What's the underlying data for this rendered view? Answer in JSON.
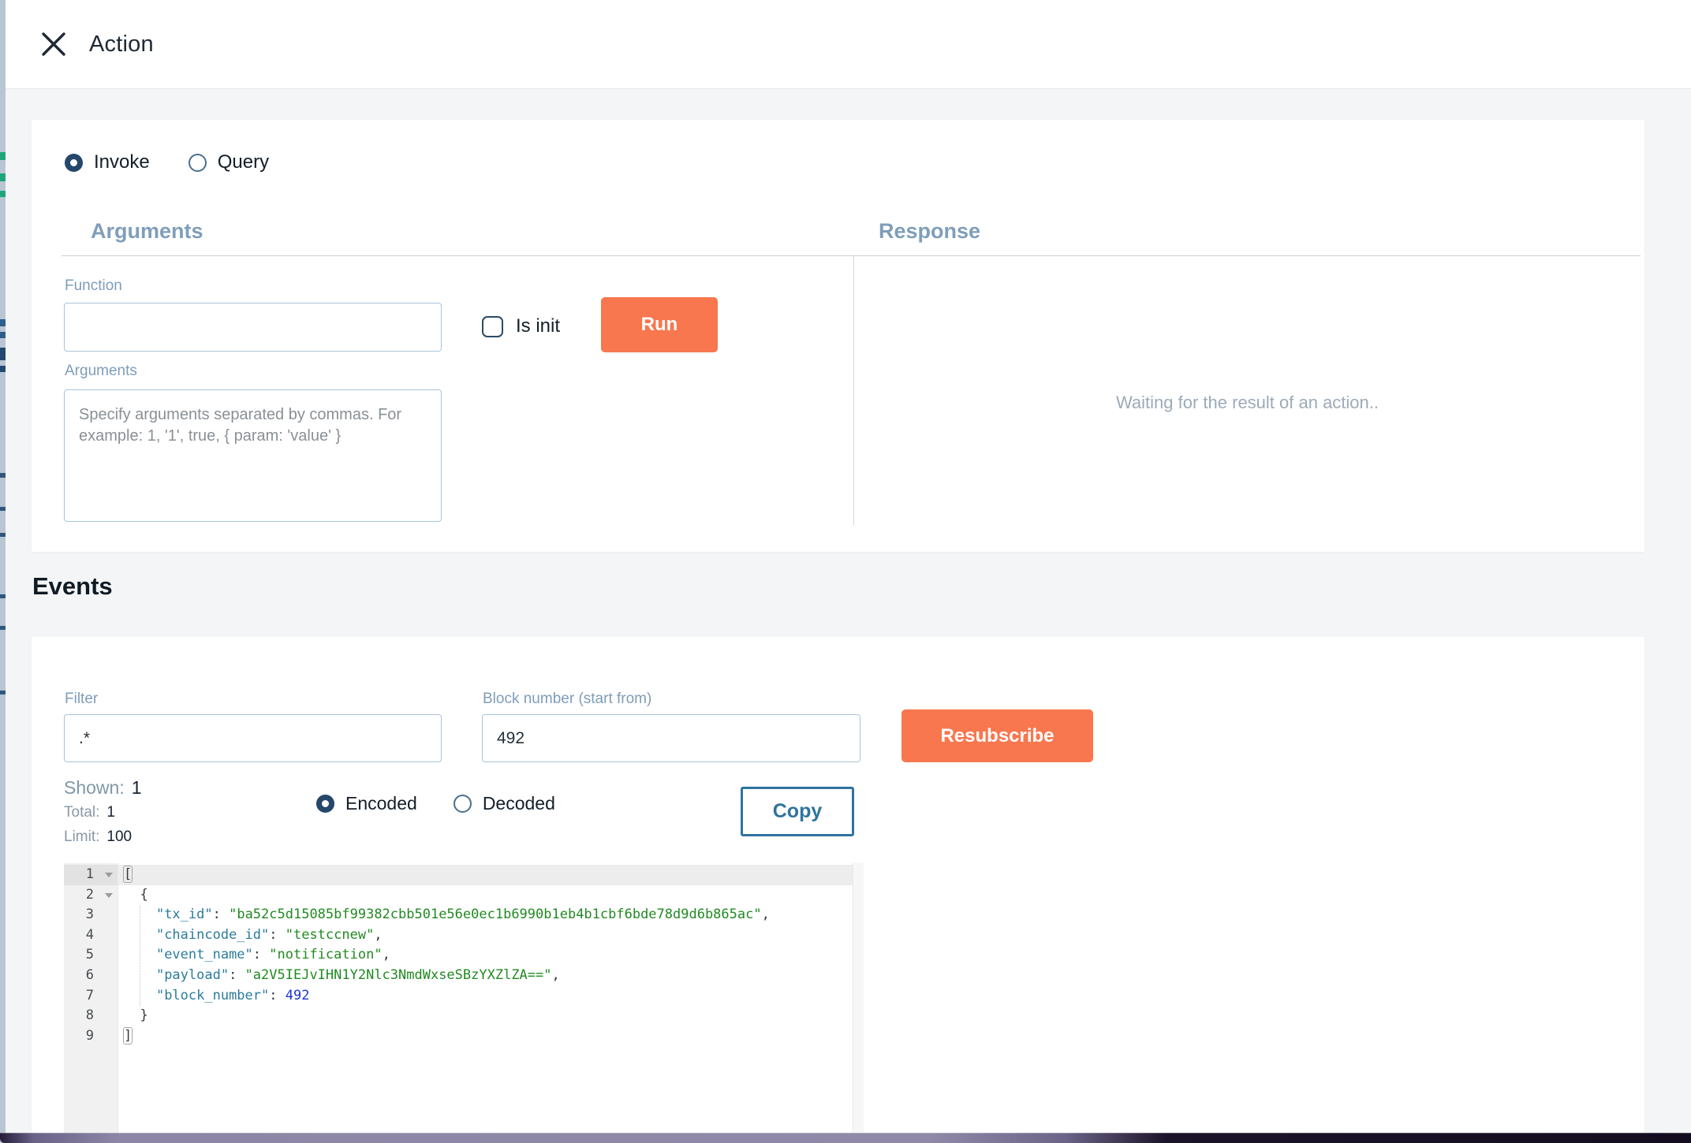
{
  "header": {
    "title": "Action",
    "close_icon": "x-close"
  },
  "action_form": {
    "modes": [
      {
        "label": "Invoke",
        "selected": true
      },
      {
        "label": "Query",
        "selected": false
      }
    ],
    "arguments_title": "Arguments",
    "response_title": "Response",
    "function_label": "Function",
    "function_value": "",
    "is_init": {
      "label": "Is init",
      "checked": false
    },
    "run_button": "Run",
    "arguments_label": "Arguments",
    "arguments_value": "",
    "arguments_placeholder": "Specify arguments separated by commas. For example: 1, '1', true, { param: 'value' }",
    "response_placeholder": "Waiting for the result of an action.."
  },
  "events": {
    "title": "Events",
    "filter": {
      "label": "Filter",
      "value": ".*"
    },
    "block_number": {
      "label": "Block number (start from)",
      "value": "492"
    },
    "resubscribe_button": "Resubscribe",
    "stats": {
      "shown_label": "Shown:",
      "shown_value": "1",
      "total_label": "Total:",
      "total_value": "1",
      "limit_label": "Limit:",
      "limit_value": "100"
    },
    "encodings": [
      {
        "label": "Encoded",
        "selected": true
      },
      {
        "label": "Decoded",
        "selected": false
      }
    ],
    "copy_button": "Copy",
    "editor": {
      "language": "json",
      "lines": [
        {
          "num": "1",
          "fold": true,
          "active": true,
          "segments": [
            {
              "t": "[",
              "s": "plain",
              "match": true
            }
          ]
        },
        {
          "num": "2",
          "fold": true,
          "segments": [
            {
              "t": "  {",
              "s": "plain"
            }
          ]
        },
        {
          "num": "3",
          "segments": [
            {
              "t": "    ",
              "s": "plain"
            },
            {
              "t": "\"tx_id\"",
              "s": "key"
            },
            {
              "t": ": ",
              "s": "plain"
            },
            {
              "t": "\"ba52c5d15085bf99382cbb501e56e0ec1b6990b1eb4b1cbf6bde78d9d6b865ac\"",
              "s": "str"
            },
            {
              "t": ",",
              "s": "plain"
            }
          ]
        },
        {
          "num": "4",
          "segments": [
            {
              "t": "    ",
              "s": "plain"
            },
            {
              "t": "\"chaincode_id\"",
              "s": "key"
            },
            {
              "t": ": ",
              "s": "plain"
            },
            {
              "t": "\"testccnew\"",
              "s": "str"
            },
            {
              "t": ",",
              "s": "plain"
            }
          ]
        },
        {
          "num": "5",
          "segments": [
            {
              "t": "    ",
              "s": "plain"
            },
            {
              "t": "\"event_name\"",
              "s": "key"
            },
            {
              "t": ": ",
              "s": "plain"
            },
            {
              "t": "\"notification\"",
              "s": "str"
            },
            {
              "t": ",",
              "s": "plain"
            }
          ]
        },
        {
          "num": "6",
          "segments": [
            {
              "t": "    ",
              "s": "plain"
            },
            {
              "t": "\"payload\"",
              "s": "key"
            },
            {
              "t": ": ",
              "s": "plain"
            },
            {
              "t": "\"a2V5IEJvIHN1Y2Nlc3NmdWxseSBzYXZlZA==\"",
              "s": "str"
            },
            {
              "t": ",",
              "s": "plain"
            }
          ]
        },
        {
          "num": "7",
          "segments": [
            {
              "t": "    ",
              "s": "plain"
            },
            {
              "t": "\"block_number\"",
              "s": "key"
            },
            {
              "t": ": ",
              "s": "plain"
            },
            {
              "t": "492",
              "s": "num"
            }
          ]
        },
        {
          "num": "8",
          "segments": [
            {
              "t": "  }",
              "s": "plain"
            }
          ]
        },
        {
          "num": "9",
          "segments": [
            {
              "t": "]",
              "s": "plain",
              "match": true
            }
          ]
        }
      ]
    }
  },
  "colors": {
    "accent_orange": "#f8774f",
    "navy": "#24476a",
    "section_heading_blue": "#7f9eba",
    "code_key": "#2b7c9d",
    "code_string": "#218a21",
    "code_number": "#1a35cf"
  }
}
